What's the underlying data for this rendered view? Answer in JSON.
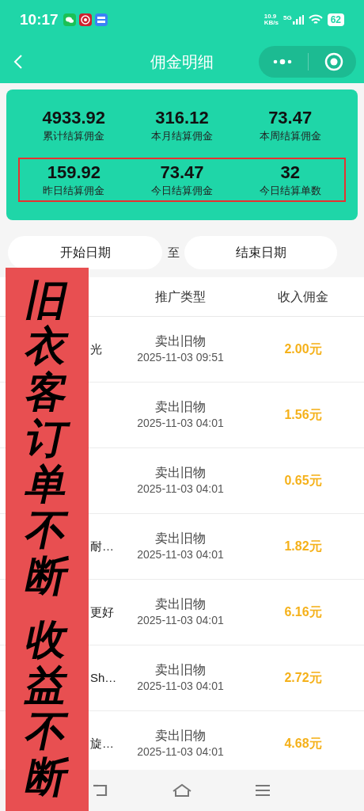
{
  "status_bar": {
    "time": "10:17",
    "net_speed_value": "10.9",
    "net_speed_unit": "KB/s",
    "network": "5G",
    "battery": "62"
  },
  "nav": {
    "title": "佣金明细"
  },
  "stats_rows": [
    {
      "highlighted": false,
      "items": [
        {
          "value": "4933.92",
          "label": "累计结算佣金"
        },
        {
          "value": "316.12",
          "label": "本月结算佣金"
        },
        {
          "value": "73.47",
          "label": "本周结算佣金"
        }
      ]
    },
    {
      "highlighted": true,
      "items": [
        {
          "value": "159.92",
          "label": "昨日结算佣金"
        },
        {
          "value": "73.47",
          "label": "今日结算佣金"
        },
        {
          "value": "32",
          "label": "今日结算单数"
        }
      ]
    }
  ],
  "date_filter": {
    "start": "开始日期",
    "separator": "至",
    "end": "结束日期"
  },
  "table": {
    "columns": [
      "推广类型",
      "收入佣金"
    ],
    "rows": [
      {
        "column_1": "光",
        "type": "卖出旧物",
        "time": "2025-11-03 09:51",
        "amount": "2.00元"
      },
      {
        "type": "卖出旧物",
        "time": "2025-11-03 04:01",
        "amount": "1.56元"
      },
      {
        "type": "卖出旧物",
        "time": "2025-11-03 04:01",
        "amount": "0.65元"
      },
      {
        "column_1": "耐…",
        "type": "卖出旧物",
        "time": "2025-11-03 04:01",
        "amount": "1.82元"
      },
      {
        "column_1": "更好",
        "type": "卖出旧物",
        "time": "2025-11-03 04:01",
        "amount": "6.16元"
      },
      {
        "column_1": "Sh…",
        "type": "卖出旧物",
        "time": "2025-11-03 04:01",
        "amount": "2.72元"
      },
      {
        "column_1": "旋…",
        "type": "卖出旧物",
        "time": "2025-11-03 04:01",
        "amount": "4.68元"
      }
    ]
  },
  "banner": {
    "lines": [
      "旧衣客订单不断",
      "收益不断"
    ]
  }
}
